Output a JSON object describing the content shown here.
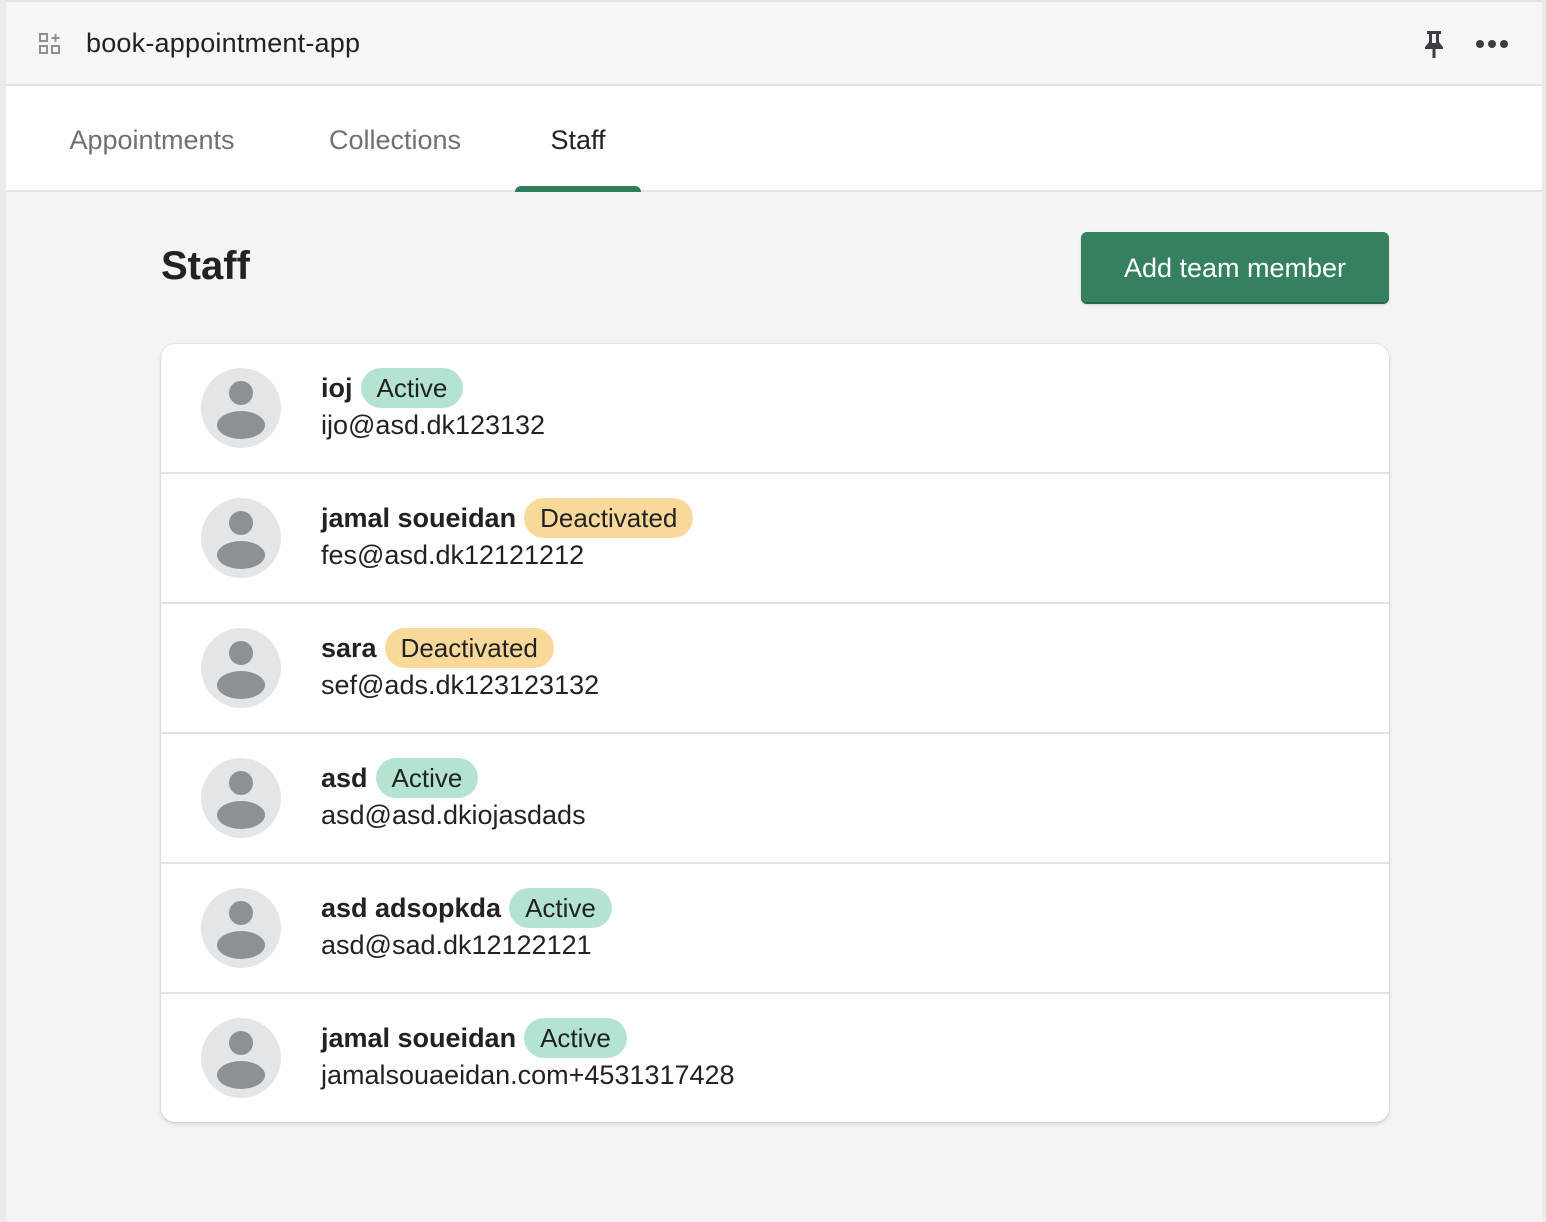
{
  "app": {
    "title": "book-appointment-app",
    "icons": {
      "app": "apps-icon",
      "pin": "pin-icon",
      "more": "more-horizontal-icon"
    }
  },
  "tabs": [
    {
      "label": "Appointments",
      "active": false
    },
    {
      "label": "Collections",
      "active": false
    },
    {
      "label": "Staff",
      "active": true
    }
  ],
  "page": {
    "title": "Staff",
    "add_button_label": "Add team member"
  },
  "colors": {
    "accent": "#35805f",
    "active_badge": "#b4e4d0",
    "deactivated_badge": "#f9d99a"
  },
  "staff": [
    {
      "name": "ioj",
      "status": "Active",
      "email": "ijo@asd.dk123132"
    },
    {
      "name": "jamal soueidan",
      "status": "Deactivated",
      "email": "fes@asd.dk12121212"
    },
    {
      "name": "sara",
      "status": "Deactivated",
      "email": "sef@ads.dk123123132"
    },
    {
      "name": "asd",
      "status": "Active",
      "email": "asd@asd.dkiojasdads"
    },
    {
      "name": "asd adsopkda",
      "status": "Active",
      "email": "asd@sad.dk12122121"
    },
    {
      "name": "jamal soueidan",
      "status": "Active",
      "email": "jamalsouaeidan.com+4531317428"
    }
  ]
}
